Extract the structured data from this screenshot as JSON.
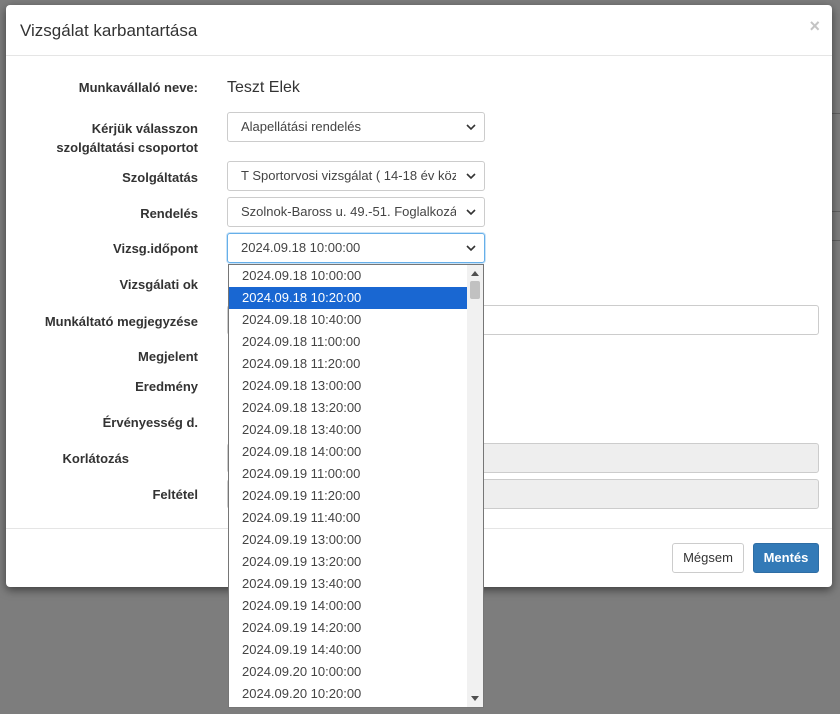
{
  "background": {
    "overlay_color": "#7d7d7d"
  },
  "modal": {
    "title": "Vizsgálat karbantartása",
    "close_label": "×",
    "fields": {
      "employee_name_label": "Munkavállaló neve:",
      "employee_name_value": "Teszt Elek",
      "service_group_label_line1": "Kérjük válasszon",
      "service_group_label_line2": "szolgáltatási csoportot",
      "service_group_value": "Alapellátási rendelés",
      "service_label": "Szolgáltatás",
      "service_value": "T Sportorvosi vizsgálat ( 14-18 év köz",
      "office_label": "Rendelés",
      "office_value": "Szolnok-Baross u. 49.-51. Foglalkozá",
      "appointment_label": "Vizsg.időpont",
      "appointment_value": "2024.09.18 10:00:00",
      "reason_label": "Vizsgálati ok",
      "employer_note_label": "Munkáltató megjegyzése",
      "appeared_label": "Megjelent",
      "result_label": "Eredmény",
      "validity_label": "Érvényesség d.",
      "restriction_label": "Korlátozás",
      "condition_label": "Feltétel"
    },
    "footer": {
      "cancel_label": "Mégsem",
      "save_label": "Mentés"
    }
  },
  "dropdown": {
    "selected_index": 1,
    "options": [
      "2024.09.18 10:00:00",
      "2024.09.18 10:20:00",
      "2024.09.18 10:40:00",
      "2024.09.18 11:00:00",
      "2024.09.18 11:20:00",
      "2024.09.18 13:00:00",
      "2024.09.18 13:20:00",
      "2024.09.18 13:40:00",
      "2024.09.18 14:00:00",
      "2024.09.19 11:00:00",
      "2024.09.19 11:20:00",
      "2024.09.19 11:40:00",
      "2024.09.19 13:00:00",
      "2024.09.19 13:20:00",
      "2024.09.19 13:40:00",
      "2024.09.19 14:00:00",
      "2024.09.19 14:20:00",
      "2024.09.19 14:40:00",
      "2024.09.20 10:00:00",
      "2024.09.20 10:20:00"
    ]
  },
  "colors": {
    "primary": "#337ab7",
    "selected_option": "#1967d2",
    "focus_border": "#66afe9"
  }
}
